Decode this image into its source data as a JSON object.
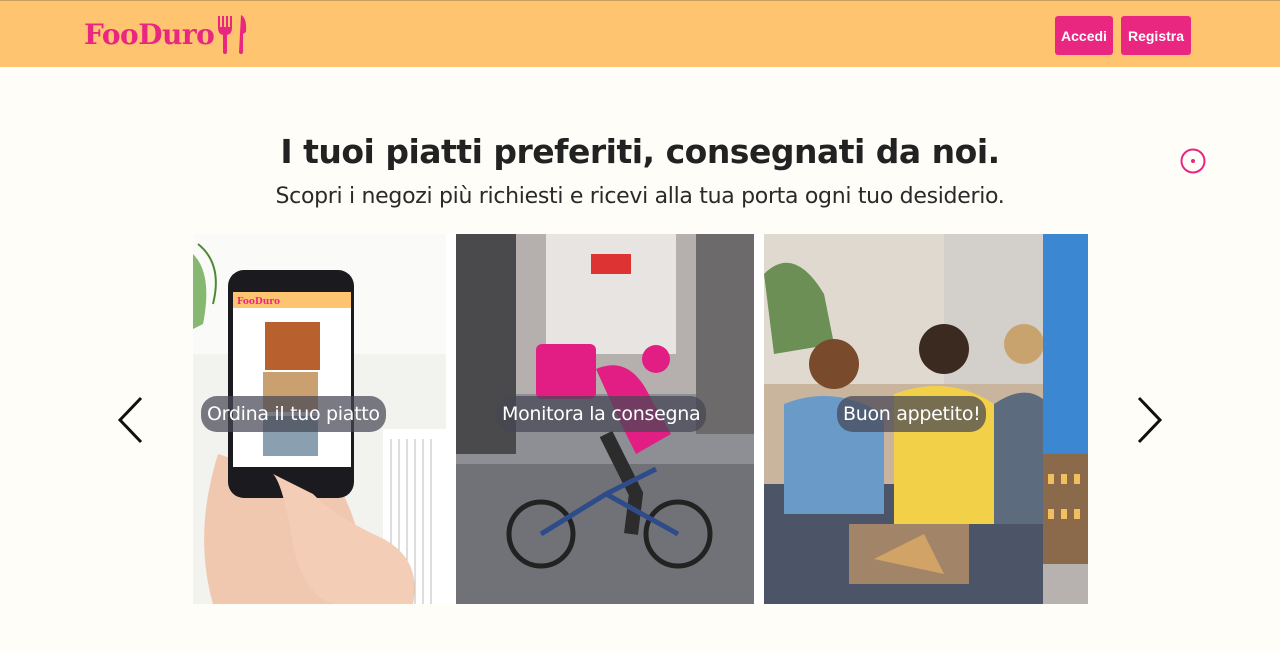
{
  "brand": {
    "name": "FooDuro",
    "accent": "#ea2780",
    "navbar_color": "#fec470"
  },
  "nav": {
    "login_label": "Accedi",
    "register_label": "Registra"
  },
  "hero": {
    "title": "I tuoi piatti preferiti, consegnati da noi.",
    "subtitle": "Scopri i negozi più richiesti e ricevi alla tua porta ogni tuo desiderio."
  },
  "carousel": {
    "slides": [
      {
        "caption": "Ordina il tuo piatto",
        "image": "phone-app-order"
      },
      {
        "caption": "Monitora la consegna",
        "image": "delivery-rider-bike"
      },
      {
        "caption": "Buon appetito!",
        "image": "friends-eating-pizza"
      },
      {
        "caption": "",
        "image": "city-building"
      }
    ],
    "prev_icon": "chevron-left-icon",
    "next_icon": "chevron-right-icon"
  },
  "extra": {
    "target_icon": "target-circle-icon"
  }
}
